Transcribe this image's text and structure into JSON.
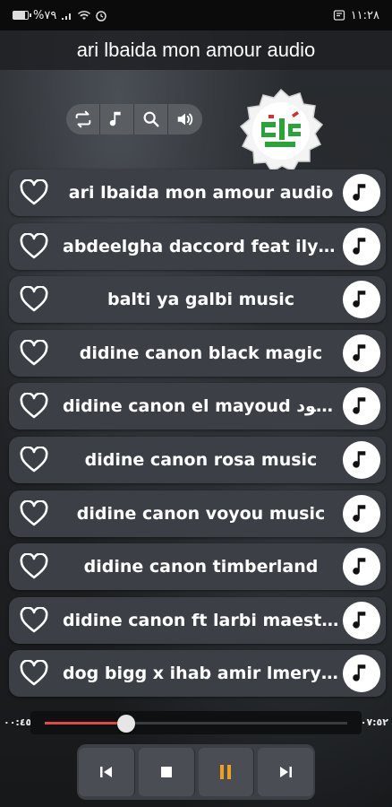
{
  "statusbar": {
    "time": "١١:٢٨",
    "battery_text": "%٧٩",
    "battery_level": 0.79,
    "icons": [
      "notification-icon",
      "wifi-icon",
      "signal-icon",
      "battery-icon",
      "alarm-icon"
    ]
  },
  "header": {
    "title": "ari lbaida mon amour audio"
  },
  "toolbar": {
    "buttons": [
      "repeat-icon",
      "music-note-icon",
      "search-icon",
      "volume-icon"
    ]
  },
  "songs": [
    {
      "title": "ari lbaida mon amour audio"
    },
    {
      "title": "abdeelgha daccord feat ily p..."
    },
    {
      "title": "balti ya galbi music"
    },
    {
      "title": "didine canon black magic"
    },
    {
      "title": "didine canon el mayoud المقيود"
    },
    {
      "title": "didine canon rosa music"
    },
    {
      "title": "didine canon voyou music"
    },
    {
      "title": "didine canon timberland"
    },
    {
      "title": "didine canon ft larbi maestro..."
    },
    {
      "title": "dog bigg x ihab amir lmeryo..."
    }
  ],
  "player": {
    "elapsed": "٠٠:٤٥",
    "duration": "٠٧:٥٢",
    "progress": 0.27,
    "controls": [
      "previous-icon",
      "stop-icon",
      "pause-icon",
      "next-icon"
    ],
    "accent_color": "#f0a020",
    "progress_color": "#e04a3f"
  }
}
